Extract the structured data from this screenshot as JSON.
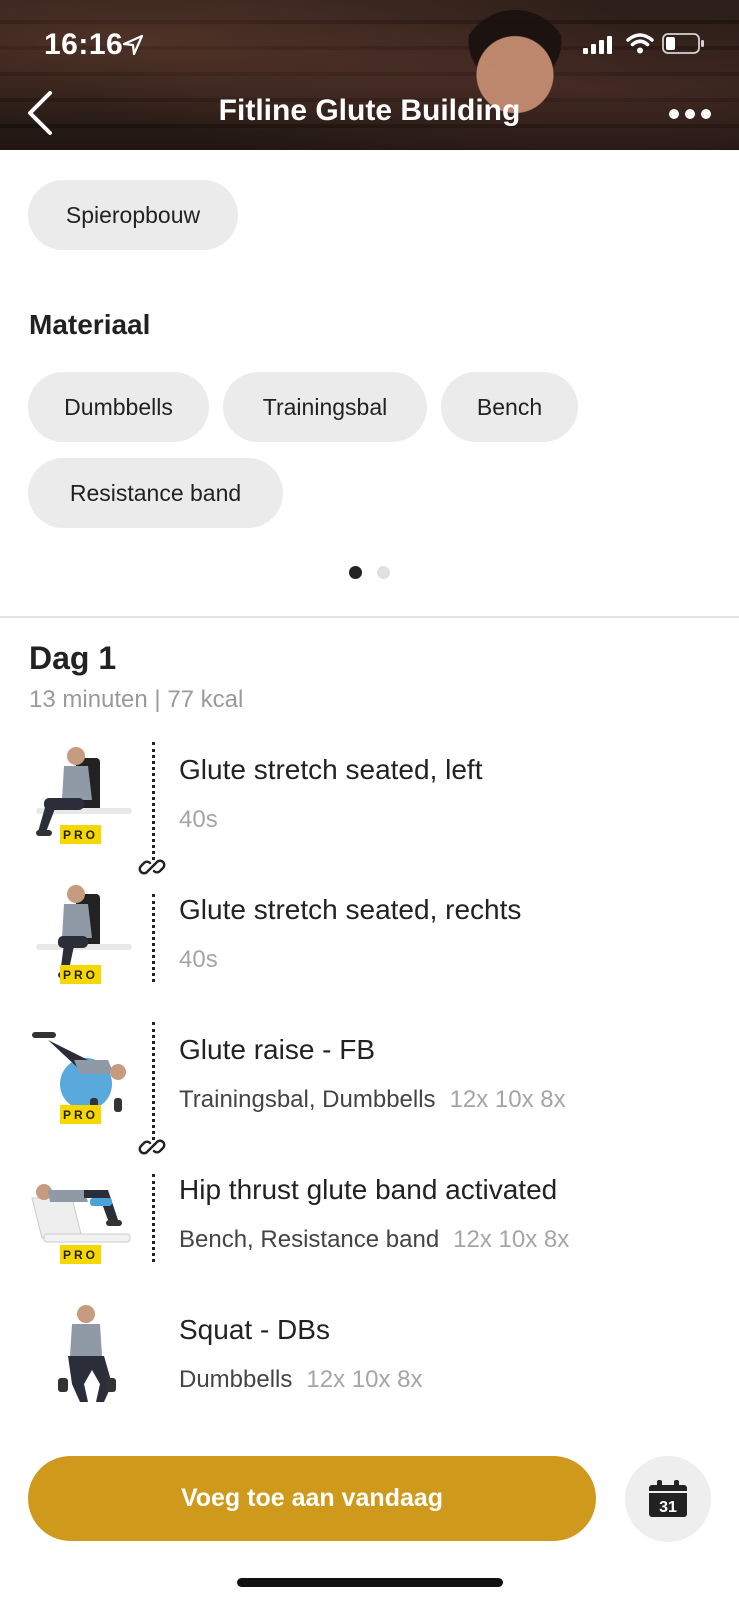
{
  "status_bar": {
    "time": "16:16"
  },
  "header": {
    "title": "Fitline Glute Building"
  },
  "goal_chips": [
    "Spieropbouw"
  ],
  "material": {
    "heading": "Materiaal",
    "chips": [
      "Dumbbells",
      "Trainingsbal",
      "Bench",
      "Resistance band"
    ]
  },
  "pager": {
    "pages": 2,
    "active": 1
  },
  "day": {
    "title": "Dag 1",
    "summary": "13 minuten | 77 kcal"
  },
  "exercises": [
    {
      "name": "Glute stretch seated, left",
      "duration": "40s",
      "equipment": "",
      "sets": "",
      "pro": "PRO"
    },
    {
      "name": "Glute stretch seated, rechts",
      "duration": "40s",
      "equipment": "",
      "sets": "",
      "pro": "PRO"
    },
    {
      "name": "Glute raise - FB",
      "duration": "",
      "equipment": "Trainingsbal, Dumbbells",
      "sets": "12x 10x 8x",
      "pro": "PRO"
    },
    {
      "name": "Hip thrust glute band activated",
      "duration": "",
      "equipment": "Bench, Resistance band",
      "sets": "12x 10x 8x",
      "pro": "PRO"
    },
    {
      "name": "Squat - DBs",
      "duration": "",
      "equipment": "Dumbbells",
      "sets": "12x 10x 8x",
      "pro": ""
    }
  ],
  "cta": {
    "label": "Voeg toe aan vandaag"
  },
  "calendar": {
    "day": "31"
  },
  "colors": {
    "accent": "#cf9a1b",
    "pro_badge": "#f6d800",
    "chip_bg": "#ebebeb"
  },
  "icons": [
    "location-arrow-icon",
    "signal-icon",
    "wifi-icon",
    "battery-icon",
    "back-icon",
    "more-icon",
    "link-icon",
    "calendar-icon"
  ]
}
